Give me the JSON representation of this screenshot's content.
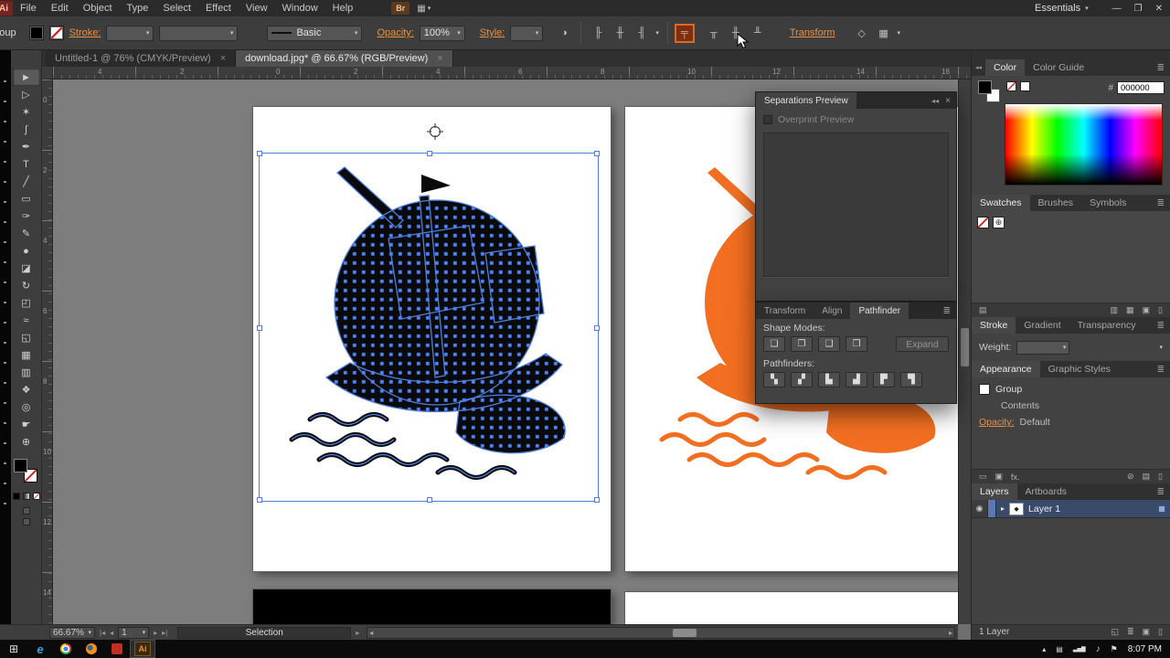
{
  "colors": {
    "selection_blue": "#4C7FE0",
    "artwork_orange": "#F26F21",
    "artwork_black": "#0A0A0A",
    "link_orange": "#E8913F"
  },
  "menu_bar": {
    "app_badge": "Ai",
    "items": [
      "File",
      "Edit",
      "Object",
      "Type",
      "Select",
      "Effect",
      "View",
      "Window",
      "Help"
    ],
    "bridge_label": "Br",
    "arrange_glyph": "▦",
    "workspace": "Essentials",
    "caret": "▾",
    "minimize_glyph": "—",
    "restore_glyph": "❐",
    "close_glyph": "✕"
  },
  "control_bar": {
    "selection_type": "Group",
    "stroke_label": "Stroke:",
    "brush_value": "Basic",
    "opacity_label": "Opacity:",
    "opacity_value": "100%",
    "style_label": "Style:",
    "transform_label": "Transform",
    "caret": "▾",
    "recolor_glyph": "◑",
    "align_glyphs": [
      "╟",
      "╫",
      "╢"
    ],
    "highlight_glyph": "╤",
    "valign_glyphs": [
      "╥",
      "╫",
      "╨"
    ],
    "isolate_glyph": "◇",
    "select_similar_glyph": "▦"
  },
  "doc_tabs": [
    {
      "title": "Untitled-1 @ 76% (CMYK/Preview)",
      "close_glyph": "×"
    },
    {
      "title": "download.jpg* @ 66.67% (RGB/Preview)",
      "close_glyph": "×"
    }
  ],
  "rulers": {
    "h": [
      "4",
      "2",
      "0",
      "2",
      "4",
      "6",
      "8",
      "10",
      "12",
      "14",
      "16"
    ],
    "v": [
      "0",
      "2",
      "4",
      "6",
      "8",
      "10",
      "12",
      "14"
    ]
  },
  "tools": [
    {
      "name": "selection-tool",
      "glyph": "►"
    },
    {
      "name": "direct-selection-tool",
      "glyph": "▷"
    },
    {
      "name": "magic-wand-tool",
      "glyph": "✶"
    },
    {
      "name": "lasso-tool",
      "glyph": "ʃ"
    },
    {
      "name": "pen-tool",
      "glyph": "✒"
    },
    {
      "name": "type-tool",
      "glyph": "T"
    },
    {
      "name": "line-segment-tool",
      "glyph": "╱"
    },
    {
      "name": "rectangle-tool",
      "glyph": "▭"
    },
    {
      "name": "paintbrush-tool",
      "glyph": "✑"
    },
    {
      "name": "pencil-tool",
      "glyph": "✎"
    },
    {
      "name": "blob-brush-tool",
      "glyph": "●"
    },
    {
      "name": "eraser-tool",
      "glyph": "◪"
    },
    {
      "name": "rotate-tool",
      "glyph": "↻"
    },
    {
      "name": "scale-tool",
      "glyph": "◰"
    },
    {
      "name": "width-tool",
      "glyph": "≈"
    },
    {
      "name": "shape-builder-tool",
      "glyph": "◱"
    },
    {
      "name": "mesh-tool",
      "glyph": "▦"
    },
    {
      "name": "gradient-tool",
      "glyph": "▥"
    },
    {
      "name": "eyedropper-tool",
      "glyph": "❖"
    },
    {
      "name": "blend-tool",
      "glyph": "◎"
    },
    {
      "name": "hand-tool",
      "glyph": "☛"
    },
    {
      "name": "zoom-tool",
      "glyph": "⊕"
    }
  ],
  "panels": {
    "separations": {
      "title": "Separations Preview",
      "collapse_glyph": "◂◂",
      "close_glyph": "×",
      "overprint_label": "Overprint Preview"
    },
    "pathfinder": {
      "tabs": [
        "Transform",
        "Align",
        "Pathfinder"
      ],
      "menu_glyph": "≣",
      "shape_modes_label": "Shape Modes:",
      "shape_mode_glyphs": [
        "❏",
        "❐",
        "❑",
        "❒"
      ],
      "expand_label": "Expand",
      "pathfinders_label": "Pathfinders:",
      "pathfinder_glyphs": [
        "▚",
        "▞",
        "▙",
        "▟",
        "▛",
        "▜"
      ]
    }
  },
  "dock": {
    "collapse_glyph": "◂◂",
    "menu_glyph": "≣",
    "color": {
      "tabs": [
        "Color",
        "Color Guide"
      ],
      "hash_label": "#",
      "hex_value": "000000"
    },
    "swatches": {
      "tabs": [
        "Swatches",
        "Brushes",
        "Symbols"
      ],
      "registration_glyph": "⊕",
      "footer_glyphs": [
        "▤",
        "▥",
        "▦",
        "▣",
        "▯"
      ]
    },
    "stroke": {
      "tabs": [
        "Stroke",
        "Gradient",
        "Transparency"
      ],
      "weight_label": "Weight:",
      "caret": "▾"
    },
    "appearance": {
      "tabs": [
        "Appearance",
        "Graphic Styles"
      ],
      "row_group": "Group",
      "row_contents": "Contents",
      "opacity_label": "Opacity:",
      "opacity_value": "Default",
      "footer_glyphs": [
        "▭",
        "▣",
        "fx.",
        "⊘",
        "▤",
        "▯"
      ]
    },
    "layers": {
      "tabs": [
        "Layers",
        "Artboards"
      ],
      "eye_glyph": "◉",
      "expand_glyph": "▸",
      "layer_name": "Layer 1",
      "thumb_glyph": "◆",
      "count_label": "1 Layer",
      "footer_glyphs": [
        "◱",
        "≣",
        "▣",
        "▯"
      ]
    }
  },
  "status_bar": {
    "zoom": "66.67%",
    "caret": "▾",
    "first_glyph": "|◂",
    "prev_glyph": "◂",
    "artboard": "1",
    "next_glyph": "▸",
    "last_glyph": "▸|",
    "tool_label": "Selection",
    "expand_glyph": "▸",
    "scroll_left_glyph": "◂",
    "scroll_right_glyph": "▸"
  },
  "taskbar": {
    "start_glyph": "⊞",
    "ie_label": "e",
    "ai_label": "Ai",
    "tray": [
      {
        "name": "hidden-icons-chevron",
        "glyph": "▴"
      },
      {
        "name": "tray-app-icon",
        "glyph": "▤"
      },
      {
        "name": "network-icon",
        "glyph": "▃▅▇"
      },
      {
        "name": "volume-icon",
        "glyph": "♪"
      },
      {
        "name": "action-center-icon",
        "glyph": "⚑"
      }
    ],
    "time": "8:07 PM"
  }
}
